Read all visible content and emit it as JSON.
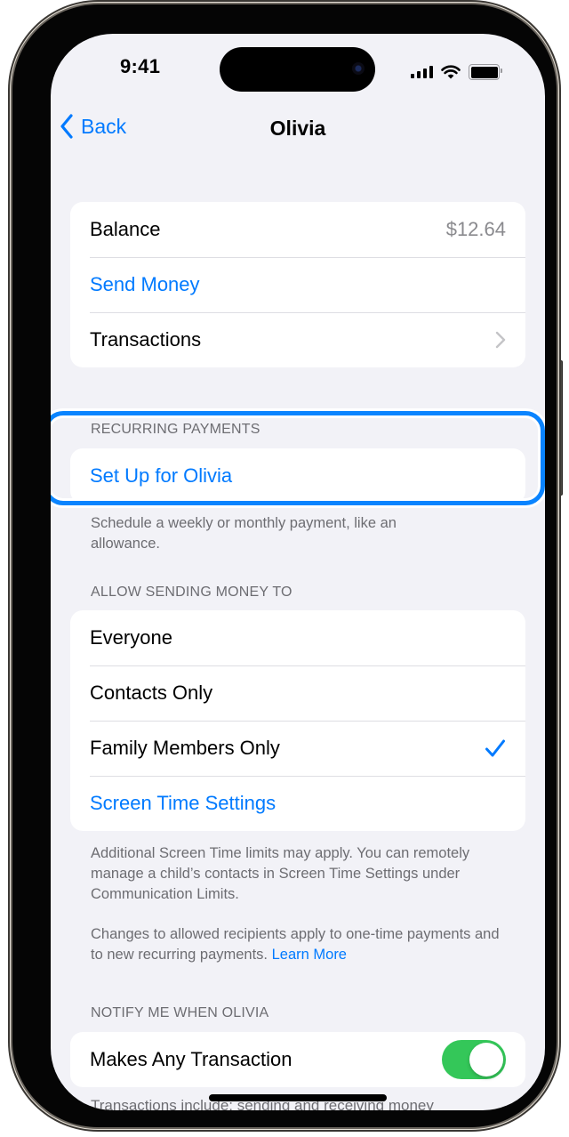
{
  "status_bar": {
    "time": "9:41",
    "icons": [
      "cellular-signal-icon",
      "wifi-icon",
      "battery-icon"
    ]
  },
  "nav": {
    "back_label": "Back",
    "back_icon": "chevron-left-icon",
    "title": "Olivia"
  },
  "account_group": {
    "balance_label": "Balance",
    "balance_value": "$12.64",
    "send_money_label": "Send Money",
    "transactions_label": "Transactions"
  },
  "recurring": {
    "header": "RECURRING PAYMENTS",
    "setup_label": "Set Up for Olivia",
    "footer": "Schedule a weekly or monthly payment, like an allowance.",
    "highlight_color": "#0a84ff"
  },
  "allow_sending": {
    "header": "ALLOW SENDING MONEY TO",
    "options": [
      {
        "label": "Everyone",
        "selected": false
      },
      {
        "label": "Contacts Only",
        "selected": false
      },
      {
        "label": "Family Members Only",
        "selected": true
      }
    ],
    "screen_time_label": "Screen Time Settings",
    "footer_1": "Additional Screen Time limits may apply. You can remotely manage a child’s contacts in Screen Time Settings under Communication Limits.",
    "footer_2": "Changes to allowed recipients apply to one-time payments and to new recurring payments.",
    "learn_more": "Learn More"
  },
  "notify": {
    "header": "NOTIFY ME WHEN OLIVIA",
    "makes_any_transaction_label": "Makes Any Transaction",
    "makes_any_transaction_on": true,
    "footer_partial": "Transactions include: sending and receiving money"
  },
  "colors": {
    "accent": "#007aff",
    "toggle_on": "#34c759",
    "background": "#f2f2f7",
    "secondary_text": "#6d6d72"
  }
}
